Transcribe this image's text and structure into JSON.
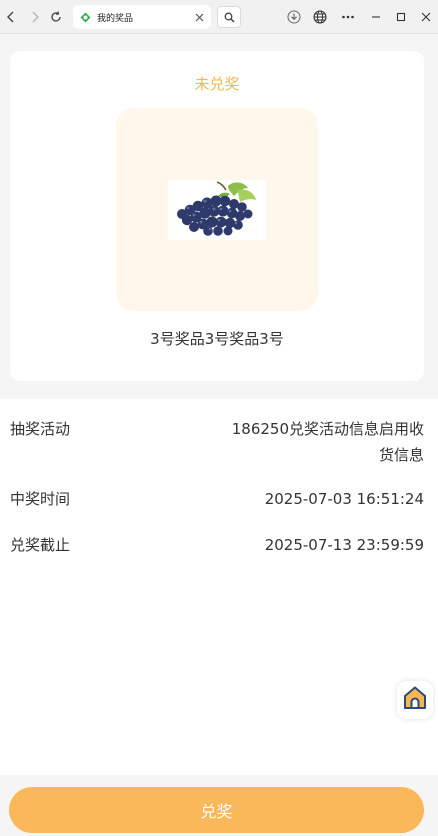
{
  "browser": {
    "tab_title": "我的奖品",
    "icons": [
      "back-icon",
      "forward-icon",
      "reload-icon",
      "site-favicon",
      "close-icon",
      "zoom-icon",
      "download-icon",
      "globe-icon",
      "more-icon",
      "minimize-icon",
      "maximize-icon",
      "window-close-icon"
    ]
  },
  "prize": {
    "status": "未兑奖",
    "name": "3号奖品3号奖品3号",
    "image_alt": "grapes"
  },
  "details": {
    "activity_label": "抽奖活动",
    "activity_value": "186250兑奖活动信息启用收货信息",
    "win_time_label": "中奖时间",
    "win_time_value": "2025-07-03 16:51:24",
    "deadline_label": "兑奖截止",
    "deadline_value": "2025-07-13 23:59:59"
  },
  "footer": {
    "redeem_label": "兑奖"
  },
  "colors": {
    "accent": "#f7b550",
    "button": "#fbb85a",
    "image_bg": "#fff6ec",
    "page_bg": "#f5f5f5"
  }
}
